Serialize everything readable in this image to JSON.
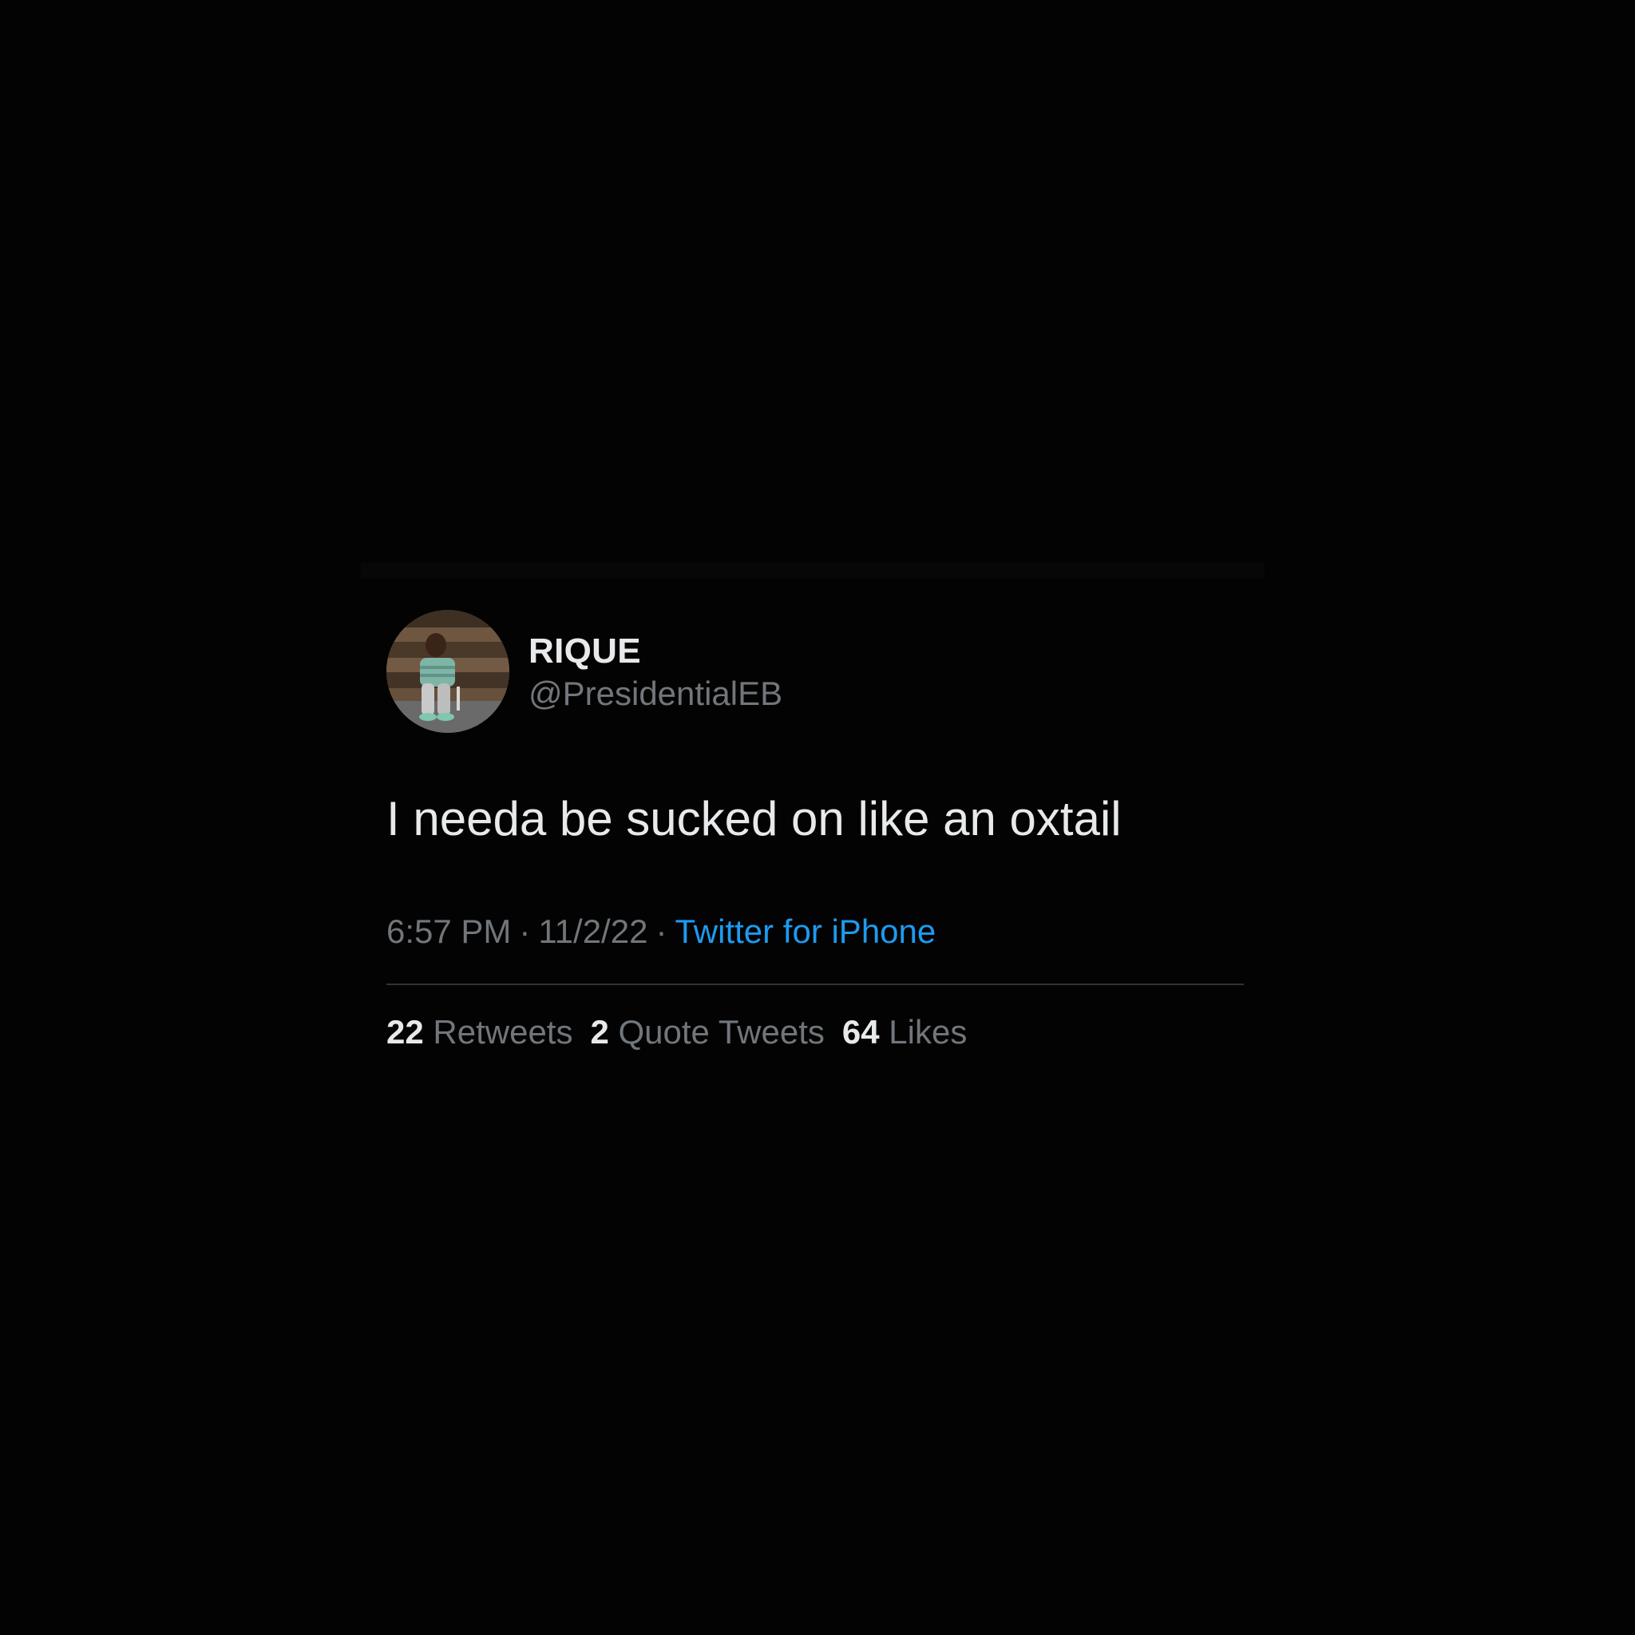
{
  "tweet": {
    "display_name": "RIQUE",
    "handle": "@PresidentialEB",
    "text": "I needa be sucked on like an oxtail",
    "time": "6:57 PM",
    "separator": "·",
    "date": "11/2/22",
    "source": "Twitter for iPhone",
    "avatar_icon": "profile-photo",
    "stats": {
      "retweets_count": "22",
      "retweets_label": "Retweets",
      "quotes_count": "2",
      "quotes_label": "Quote Tweets",
      "likes_count": "64",
      "likes_label": "Likes"
    }
  },
  "colors": {
    "background": "#030303",
    "primary_text": "#e7e9ea",
    "secondary_text": "#71767b",
    "link": "#1d9bf0",
    "divider": "#2f3336"
  }
}
